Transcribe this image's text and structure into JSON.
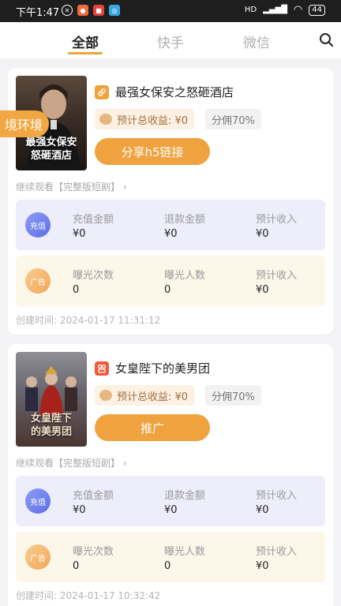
{
  "status_bar": {
    "time": "下午1:47",
    "network": "HD",
    "battery": "44"
  },
  "tabs": [
    {
      "label": "全部",
      "active": true
    },
    {
      "label": "快手",
      "active": false
    },
    {
      "label": "微信",
      "active": false
    }
  ],
  "floating_tag": "境环境",
  "cards": [
    {
      "poster_title": "最强女保安\n怒砸酒店",
      "title": "最强女保安之怒砸酒店",
      "icon": "link-icon",
      "icon_color": "#f0a33a",
      "earn_label": "预计总收益: ¥0",
      "commission": "分佣70%",
      "button_label": "分享h5链接",
      "continue_text": "继续观看【完整版短剧】",
      "recharge_panel": {
        "badge": "充值",
        "labels": [
          "充值金额",
          "退款金额",
          "预计收入"
        ],
        "values": [
          "¥0",
          "¥0",
          "¥0"
        ]
      },
      "ad_panel": {
        "badge": "广告",
        "labels": [
          "曝光次数",
          "曝光人数",
          "预计收入"
        ],
        "values": [
          "0",
          "0",
          "¥0"
        ]
      },
      "created": "创建时间: 2024-01-17 11:31:12"
    },
    {
      "poster_title": "女皇陛下\n的美男团",
      "title": "女皇陛下的美男团",
      "icon": "kuaishou-icon",
      "icon_color": "#f05a3b",
      "earn_label": "预计总收益: ¥0",
      "commission": "分佣70%",
      "button_label": "推广",
      "continue_text": "继续观看【完整版短剧】",
      "recharge_panel": {
        "badge": "充值",
        "labels": [
          "充值金额",
          "退款金额",
          "预计收入"
        ],
        "values": [
          "¥0",
          "¥0",
          "¥0"
        ]
      },
      "ad_panel": {
        "badge": "广告",
        "labels": [
          "曝光次数",
          "曝光人数",
          "预计收入"
        ],
        "values": [
          "0",
          "0",
          "¥0"
        ]
      },
      "created": "创建时间: 2024-01-17 10:32:42"
    }
  ]
}
